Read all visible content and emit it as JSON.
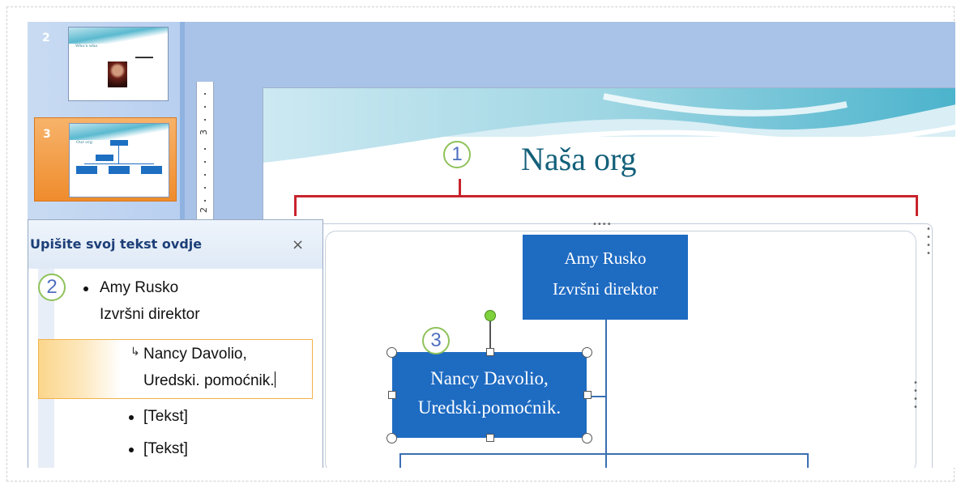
{
  "thumbnails": [
    {
      "number": "2",
      "title": "Who's who",
      "selected": false
    },
    {
      "number": "3",
      "title": "Our org",
      "selected": true
    }
  ],
  "ruler": {
    "mark": "3",
    "mark2": "2"
  },
  "slide": {
    "title": "Naša org",
    "callouts": [
      "1",
      "2",
      "3"
    ]
  },
  "org_chart": {
    "top": {
      "name": "Amy Rusko",
      "role": "Izvršni direktor"
    },
    "assistant": {
      "line1": "Nancy Davolio,",
      "line2": "Uredski.pomoćnik."
    }
  },
  "text_pane": {
    "title": "Upišite svoj tekst ovdje",
    "close": "×",
    "items": [
      {
        "line1": "Amy Rusko",
        "line2": "Izvršni direktor"
      },
      {
        "line1": "Nancy Davolio,",
        "line2": "Uredski. pomoćnik."
      },
      {
        "line1": "[Tekst]"
      },
      {
        "line1": "[Tekst]"
      }
    ],
    "sub_arrow": "↳"
  },
  "colors": {
    "accent_box": "#1e6bc2",
    "selection_orange": "#ef8c2d",
    "callout_green": "#8fc25a",
    "bracket_red": "#c8232c",
    "title_teal": "#13607a"
  }
}
